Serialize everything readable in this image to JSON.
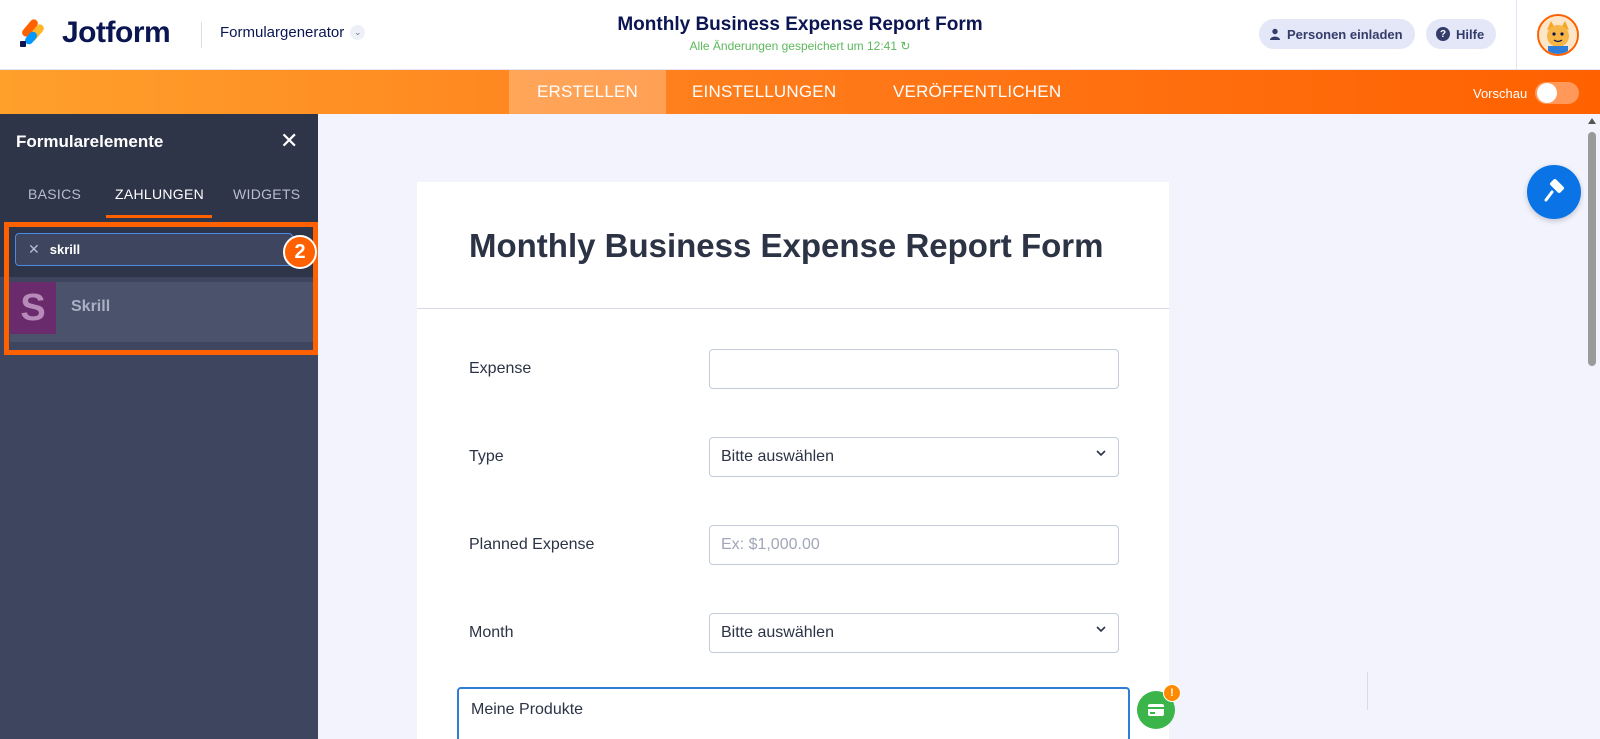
{
  "header": {
    "logo_text": "Jotform",
    "builder_menu": "Formulargenerator",
    "form_title": "Monthly Business Expense Report Form",
    "save_status": "Alle Änderungen gespeichert um 12:41",
    "invite_label": "Personen einladen",
    "help_label": "Hilfe"
  },
  "nav": {
    "tabs": [
      {
        "label": "ERSTELLEN",
        "active": true
      },
      {
        "label": "EINSTELLUNGEN",
        "active": false
      },
      {
        "label": "VERÖFFENTLICHEN",
        "active": false
      }
    ],
    "preview_label": "Vorschau",
    "preview_on": false
  },
  "sidebar": {
    "title": "Formularelemente",
    "tabs": [
      {
        "label": "BASICS",
        "active": false
      },
      {
        "label": "ZAHLUNGEN",
        "active": true
      },
      {
        "label": "WIDGETS",
        "active": false
      }
    ],
    "search_value": "skrill",
    "results": [
      {
        "icon_letter": "S",
        "label": "Skrill"
      }
    ],
    "step_badge": "2"
  },
  "form": {
    "heading": "Monthly Business Expense Report Form",
    "fields": [
      {
        "label": "Expense",
        "type": "text",
        "value": "",
        "placeholder": ""
      },
      {
        "label": "Type",
        "type": "select",
        "value": "Bitte auswählen"
      },
      {
        "label": "Planned Expense",
        "type": "text",
        "value": "",
        "placeholder": "Ex: $1,000.00"
      },
      {
        "label": "Month",
        "type": "select",
        "value": "Bitte auswählen"
      }
    ],
    "products_label": "Meine Produkte"
  },
  "badges": {
    "payment_warning": "!"
  },
  "colors": {
    "brand_orange": "#ff6100",
    "nav_gradient_start": "#ffa02b",
    "sidebar_bg": "#3e465f",
    "accent_blue": "#0a74e6",
    "payment_green": "#3bb54a",
    "save_green": "#5cb85c"
  }
}
